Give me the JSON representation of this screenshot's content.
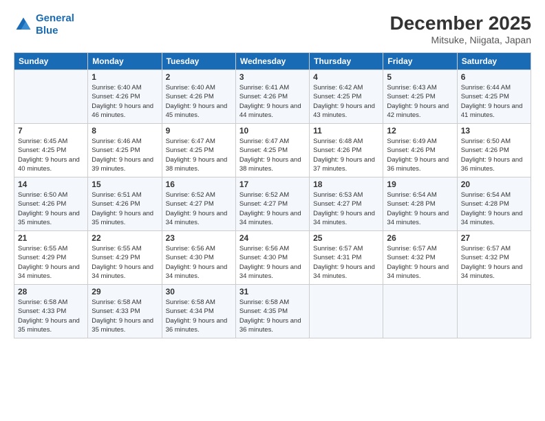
{
  "logo": {
    "line1": "General",
    "line2": "Blue"
  },
  "title": "December 2025",
  "subtitle": "Mitsuke, Niigata, Japan",
  "weekdays": [
    "Sunday",
    "Monday",
    "Tuesday",
    "Wednesday",
    "Thursday",
    "Friday",
    "Saturday"
  ],
  "weeks": [
    [
      {
        "num": "",
        "sunrise": "",
        "sunset": "",
        "daylight": ""
      },
      {
        "num": "1",
        "sunrise": "Sunrise: 6:40 AM",
        "sunset": "Sunset: 4:26 PM",
        "daylight": "Daylight: 9 hours and 46 minutes."
      },
      {
        "num": "2",
        "sunrise": "Sunrise: 6:40 AM",
        "sunset": "Sunset: 4:26 PM",
        "daylight": "Daylight: 9 hours and 45 minutes."
      },
      {
        "num": "3",
        "sunrise": "Sunrise: 6:41 AM",
        "sunset": "Sunset: 4:26 PM",
        "daylight": "Daylight: 9 hours and 44 minutes."
      },
      {
        "num": "4",
        "sunrise": "Sunrise: 6:42 AM",
        "sunset": "Sunset: 4:25 PM",
        "daylight": "Daylight: 9 hours and 43 minutes."
      },
      {
        "num": "5",
        "sunrise": "Sunrise: 6:43 AM",
        "sunset": "Sunset: 4:25 PM",
        "daylight": "Daylight: 9 hours and 42 minutes."
      },
      {
        "num": "6",
        "sunrise": "Sunrise: 6:44 AM",
        "sunset": "Sunset: 4:25 PM",
        "daylight": "Daylight: 9 hours and 41 minutes."
      }
    ],
    [
      {
        "num": "7",
        "sunrise": "Sunrise: 6:45 AM",
        "sunset": "Sunset: 4:25 PM",
        "daylight": "Daylight: 9 hours and 40 minutes."
      },
      {
        "num": "8",
        "sunrise": "Sunrise: 6:46 AM",
        "sunset": "Sunset: 4:25 PM",
        "daylight": "Daylight: 9 hours and 39 minutes."
      },
      {
        "num": "9",
        "sunrise": "Sunrise: 6:47 AM",
        "sunset": "Sunset: 4:25 PM",
        "daylight": "Daylight: 9 hours and 38 minutes."
      },
      {
        "num": "10",
        "sunrise": "Sunrise: 6:47 AM",
        "sunset": "Sunset: 4:25 PM",
        "daylight": "Daylight: 9 hours and 38 minutes."
      },
      {
        "num": "11",
        "sunrise": "Sunrise: 6:48 AM",
        "sunset": "Sunset: 4:26 PM",
        "daylight": "Daylight: 9 hours and 37 minutes."
      },
      {
        "num": "12",
        "sunrise": "Sunrise: 6:49 AM",
        "sunset": "Sunset: 4:26 PM",
        "daylight": "Daylight: 9 hours and 36 minutes."
      },
      {
        "num": "13",
        "sunrise": "Sunrise: 6:50 AM",
        "sunset": "Sunset: 4:26 PM",
        "daylight": "Daylight: 9 hours and 36 minutes."
      }
    ],
    [
      {
        "num": "14",
        "sunrise": "Sunrise: 6:50 AM",
        "sunset": "Sunset: 4:26 PM",
        "daylight": "Daylight: 9 hours and 35 minutes."
      },
      {
        "num": "15",
        "sunrise": "Sunrise: 6:51 AM",
        "sunset": "Sunset: 4:26 PM",
        "daylight": "Daylight: 9 hours and 35 minutes."
      },
      {
        "num": "16",
        "sunrise": "Sunrise: 6:52 AM",
        "sunset": "Sunset: 4:27 PM",
        "daylight": "Daylight: 9 hours and 34 minutes."
      },
      {
        "num": "17",
        "sunrise": "Sunrise: 6:52 AM",
        "sunset": "Sunset: 4:27 PM",
        "daylight": "Daylight: 9 hours and 34 minutes."
      },
      {
        "num": "18",
        "sunrise": "Sunrise: 6:53 AM",
        "sunset": "Sunset: 4:27 PM",
        "daylight": "Daylight: 9 hours and 34 minutes."
      },
      {
        "num": "19",
        "sunrise": "Sunrise: 6:54 AM",
        "sunset": "Sunset: 4:28 PM",
        "daylight": "Daylight: 9 hours and 34 minutes."
      },
      {
        "num": "20",
        "sunrise": "Sunrise: 6:54 AM",
        "sunset": "Sunset: 4:28 PM",
        "daylight": "Daylight: 9 hours and 34 minutes."
      }
    ],
    [
      {
        "num": "21",
        "sunrise": "Sunrise: 6:55 AM",
        "sunset": "Sunset: 4:29 PM",
        "daylight": "Daylight: 9 hours and 34 minutes."
      },
      {
        "num": "22",
        "sunrise": "Sunrise: 6:55 AM",
        "sunset": "Sunset: 4:29 PM",
        "daylight": "Daylight: 9 hours and 34 minutes."
      },
      {
        "num": "23",
        "sunrise": "Sunrise: 6:56 AM",
        "sunset": "Sunset: 4:30 PM",
        "daylight": "Daylight: 9 hours and 34 minutes."
      },
      {
        "num": "24",
        "sunrise": "Sunrise: 6:56 AM",
        "sunset": "Sunset: 4:30 PM",
        "daylight": "Daylight: 9 hours and 34 minutes."
      },
      {
        "num": "25",
        "sunrise": "Sunrise: 6:57 AM",
        "sunset": "Sunset: 4:31 PM",
        "daylight": "Daylight: 9 hours and 34 minutes."
      },
      {
        "num": "26",
        "sunrise": "Sunrise: 6:57 AM",
        "sunset": "Sunset: 4:32 PM",
        "daylight": "Daylight: 9 hours and 34 minutes."
      },
      {
        "num": "27",
        "sunrise": "Sunrise: 6:57 AM",
        "sunset": "Sunset: 4:32 PM",
        "daylight": "Daylight: 9 hours and 34 minutes."
      }
    ],
    [
      {
        "num": "28",
        "sunrise": "Sunrise: 6:58 AM",
        "sunset": "Sunset: 4:33 PM",
        "daylight": "Daylight: 9 hours and 35 minutes."
      },
      {
        "num": "29",
        "sunrise": "Sunrise: 6:58 AM",
        "sunset": "Sunset: 4:33 PM",
        "daylight": "Daylight: 9 hours and 35 minutes."
      },
      {
        "num": "30",
        "sunrise": "Sunrise: 6:58 AM",
        "sunset": "Sunset: 4:34 PM",
        "daylight": "Daylight: 9 hours and 36 minutes."
      },
      {
        "num": "31",
        "sunrise": "Sunrise: 6:58 AM",
        "sunset": "Sunset: 4:35 PM",
        "daylight": "Daylight: 9 hours and 36 minutes."
      },
      {
        "num": "",
        "sunrise": "",
        "sunset": "",
        "daylight": ""
      },
      {
        "num": "",
        "sunrise": "",
        "sunset": "",
        "daylight": ""
      },
      {
        "num": "",
        "sunrise": "",
        "sunset": "",
        "daylight": ""
      }
    ]
  ]
}
